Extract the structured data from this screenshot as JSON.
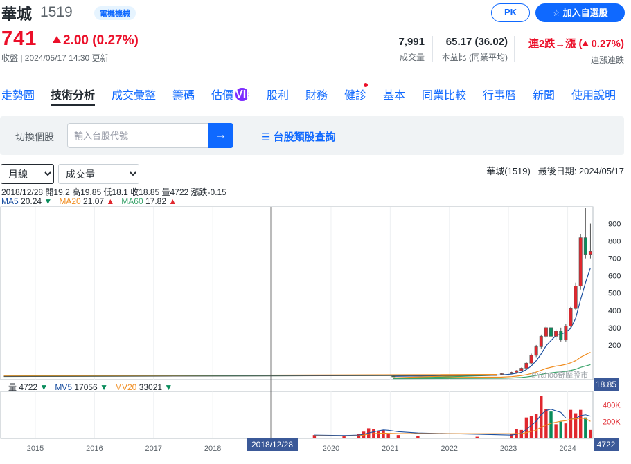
{
  "stock": {
    "name": "華城",
    "code": "1519",
    "industry": "電機機械",
    "price": "741",
    "change": "2.00",
    "change_pct": "(0.27%)",
    "close_status": "收盤 | 2024/05/17 14:30 更新"
  },
  "actions": {
    "pk_label": "PK",
    "watchlist_label": "加入自選股"
  },
  "stats": {
    "volume_value": "7,991",
    "volume_label": "成交量",
    "pe_value": "65.17 (36.02)",
    "pe_label": "本益比 (同業平均)",
    "streak_value_prefix": "連2跌→漲 (",
    "streak_value_pct": "0.27%)",
    "streak_label": "連漲連跌"
  },
  "nav": {
    "tabs": [
      "走勢圖",
      "技術分析",
      "成交彙整",
      "籌碼",
      "估價",
      "股利",
      "財務",
      "健診",
      "基本",
      "同業比較",
      "行事曆",
      "新聞",
      "使用說明"
    ],
    "vip": "VIP",
    "active": "技術分析"
  },
  "search": {
    "label": "切換個股",
    "placeholder": "輸入台股代號",
    "go_icon": "→",
    "category_link": "台股類股查詢"
  },
  "controls": {
    "period": "月線",
    "period_options": [
      "月線"
    ],
    "indicator": "成交量",
    "indicator_options": [
      "成交量"
    ],
    "title": "華城(1519)",
    "last_date": "最後日期: 2024/05/17"
  },
  "ohlc": {
    "date": "2018/12/28",
    "text": "開19.2 高19.85 低18.1 收18.85 量4722 漲跌-0.15"
  },
  "ma": {
    "ma5_label": "MA5",
    "ma5": "20.24",
    "ma20_label": "MA20",
    "ma20": "21.07",
    "ma60_label": "MA60",
    "ma60": "17.82"
  },
  "vol_legend": {
    "vol_label": "量",
    "vol": "4722",
    "mv5_label": "MV5",
    "mv5": "17056",
    "mv20_label": "MV20",
    "mv20": "33021"
  },
  "watermark": "©Yahoo奇摩股市",
  "colors": {
    "up": "#e0272e",
    "down": "#0a8c5c",
    "ma5": "#1a4fa0",
    "ma20": "#f08c1e",
    "ma60": "#3aa36b",
    "accent": "#0f69ff"
  },
  "chart_data": {
    "type": "candlestick",
    "title": "華城(1519)",
    "price_axis": {
      "ticks": [
        200,
        300,
        400,
        500,
        600,
        700,
        800,
        900
      ],
      "range": [
        0,
        990
      ]
    },
    "volume_axis": {
      "ticks": [
        "200K",
        "400K"
      ],
      "tick_values": [
        200000,
        400000
      ],
      "range": [
        0,
        560000
      ]
    },
    "x_axis": {
      "ticks": [
        "2015",
        "2016",
        "2017",
        "2018",
        "2019",
        "2020",
        "2021",
        "2022",
        "2023",
        "2024"
      ],
      "start": "2014-06",
      "end": "2024-05"
    },
    "cursor": {
      "date": "2018/12/28",
      "price": "18.85",
      "volume": "4722"
    },
    "candles": [
      {
        "t": "2021-01",
        "o": 20,
        "h": 22,
        "l": 18,
        "c": 19
      },
      {
        "t": "2022-11",
        "o": 30,
        "h": 36,
        "l": 28,
        "c": 34
      },
      {
        "t": "2023-01",
        "o": 35,
        "h": 45,
        "l": 33,
        "c": 42
      },
      {
        "t": "2023-02",
        "o": 42,
        "h": 55,
        "l": 40,
        "c": 52
      },
      {
        "t": "2023-03",
        "o": 52,
        "h": 70,
        "l": 50,
        "c": 66
      },
      {
        "t": "2023-04",
        "o": 66,
        "h": 100,
        "l": 62,
        "c": 95
      },
      {
        "t": "2023-05",
        "o": 95,
        "h": 150,
        "l": 90,
        "c": 140
      },
      {
        "t": "2023-06",
        "o": 140,
        "h": 200,
        "l": 130,
        "c": 190
      },
      {
        "t": "2023-07",
        "o": 190,
        "h": 260,
        "l": 180,
        "c": 250
      },
      {
        "t": "2023-08",
        "o": 250,
        "h": 310,
        "l": 240,
        "c": 300
      },
      {
        "t": "2023-09",
        "o": 300,
        "h": 310,
        "l": 240,
        "c": 250
      },
      {
        "t": "2023-10",
        "o": 250,
        "h": 290,
        "l": 230,
        "c": 280
      },
      {
        "t": "2023-11",
        "o": 280,
        "h": 300,
        "l": 220,
        "c": 230
      },
      {
        "t": "2023-12",
        "o": 230,
        "h": 320,
        "l": 220,
        "c": 310
      },
      {
        "t": "2024-01",
        "o": 310,
        "h": 420,
        "l": 300,
        "c": 410
      },
      {
        "t": "2024-02",
        "o": 410,
        "h": 560,
        "l": 400,
        "c": 540
      },
      {
        "t": "2024-03",
        "o": 540,
        "h": 840,
        "l": 520,
        "c": 820
      },
      {
        "t": "2024-04",
        "o": 820,
        "h": 990,
        "l": 700,
        "c": 720
      },
      {
        "t": "2024-05",
        "o": 720,
        "h": 900,
        "l": 700,
        "c": 741
      }
    ],
    "volumes": [
      {
        "t": "2019-09",
        "v": 40000
      },
      {
        "t": "2020-03",
        "v": 30000
      },
      {
        "t": "2020-06",
        "v": 50000
      },
      {
        "t": "2020-07",
        "v": 80000
      },
      {
        "t": "2020-08",
        "v": 120000
      },
      {
        "t": "2020-09",
        "v": 110000
      },
      {
        "t": "2020-10",
        "v": 90000
      },
      {
        "t": "2020-11",
        "v": 100000
      },
      {
        "t": "2020-12",
        "v": 60000
      },
      {
        "t": "2021-02",
        "v": 40000
      },
      {
        "t": "2021-06",
        "v": 30000
      },
      {
        "t": "2022-06",
        "v": 20000
      },
      {
        "t": "2023-01",
        "v": 50000
      },
      {
        "t": "2023-02",
        "v": 110000
      },
      {
        "t": "2023-03",
        "v": 100000
      },
      {
        "t": "2023-04",
        "v": 250000
      },
      {
        "t": "2023-05",
        "v": 270000
      },
      {
        "t": "2023-06",
        "v": 290000
      },
      {
        "t": "2023-07",
        "v": 510000
      },
      {
        "t": "2023-08",
        "v": 350000
      },
      {
        "t": "2023-09",
        "v": 320000
      },
      {
        "t": "2023-10",
        "v": 170000
      },
      {
        "t": "2023-11",
        "v": 200000
      },
      {
        "t": "2023-12",
        "v": 180000
      },
      {
        "t": "2024-01",
        "v": 340000
      },
      {
        "t": "2024-02",
        "v": 300000
      },
      {
        "t": "2024-03",
        "v": 340000
      },
      {
        "t": "2024-04",
        "v": 250000
      },
      {
        "t": "2024-05",
        "v": 100000
      }
    ]
  }
}
